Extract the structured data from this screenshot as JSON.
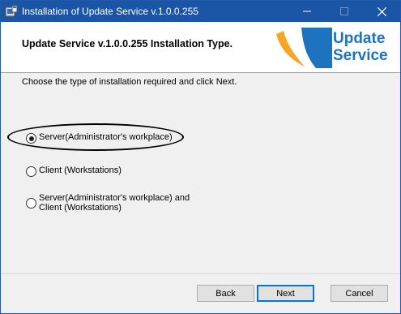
{
  "window": {
    "title": "Installation of Update Service v.1.0.0.255",
    "colors": {
      "titlebar": "#1b56a6",
      "logo_blue": "#1e73be",
      "logo_orange": "#f5a623"
    }
  },
  "header": {
    "heading": "Update Service v.1.0.0.255 Installation Type.",
    "logo_line1": "Update",
    "logo_line2": "Service"
  },
  "body": {
    "instruction": "Choose the type of installation required and click Next.",
    "options": [
      {
        "label": "Server(Administrator's workplace)",
        "checked": true
      },
      {
        "label": "Client (Workstations)",
        "checked": false
      },
      {
        "label_line1": "Server(Administrator's workplace) and",
        "label_line2": "Client (Workstations)",
        "checked": false
      }
    ]
  },
  "footer": {
    "back_label": "Back",
    "next_label": "Next",
    "cancel_label": "Cancel"
  }
}
